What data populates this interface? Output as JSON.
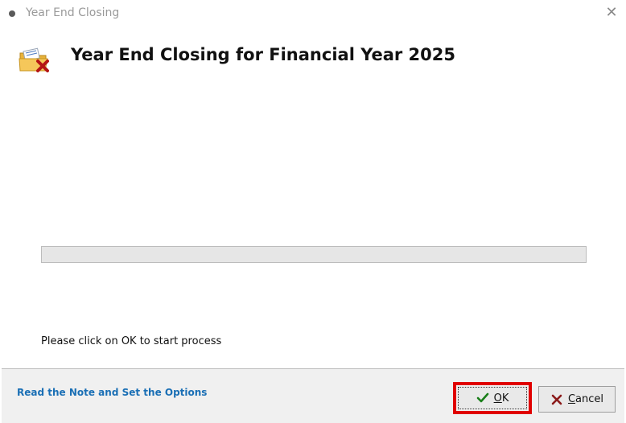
{
  "window": {
    "title": "Year End Closing",
    "close_glyph": "✕"
  },
  "header": {
    "icon": "folder-delete-icon",
    "title": "Year End Closing for Financial Year 2025"
  },
  "progress": {
    "value_percent": 0
  },
  "status": {
    "message": "Please click on OK to start process"
  },
  "footer": {
    "note_link": "Read the Note and Set the Options",
    "ok_button": {
      "mnemonic": "O",
      "rest": "K",
      "icon": "check-icon"
    },
    "cancel_button": {
      "mnemonic": "C",
      "rest": "ancel",
      "icon": "x-icon"
    }
  },
  "colors": {
    "link": "#1a6fb5",
    "highlight_box": "#e00000",
    "check_icon": "#1a7f1a",
    "cancel_icon": "#8b1a1a"
  }
}
